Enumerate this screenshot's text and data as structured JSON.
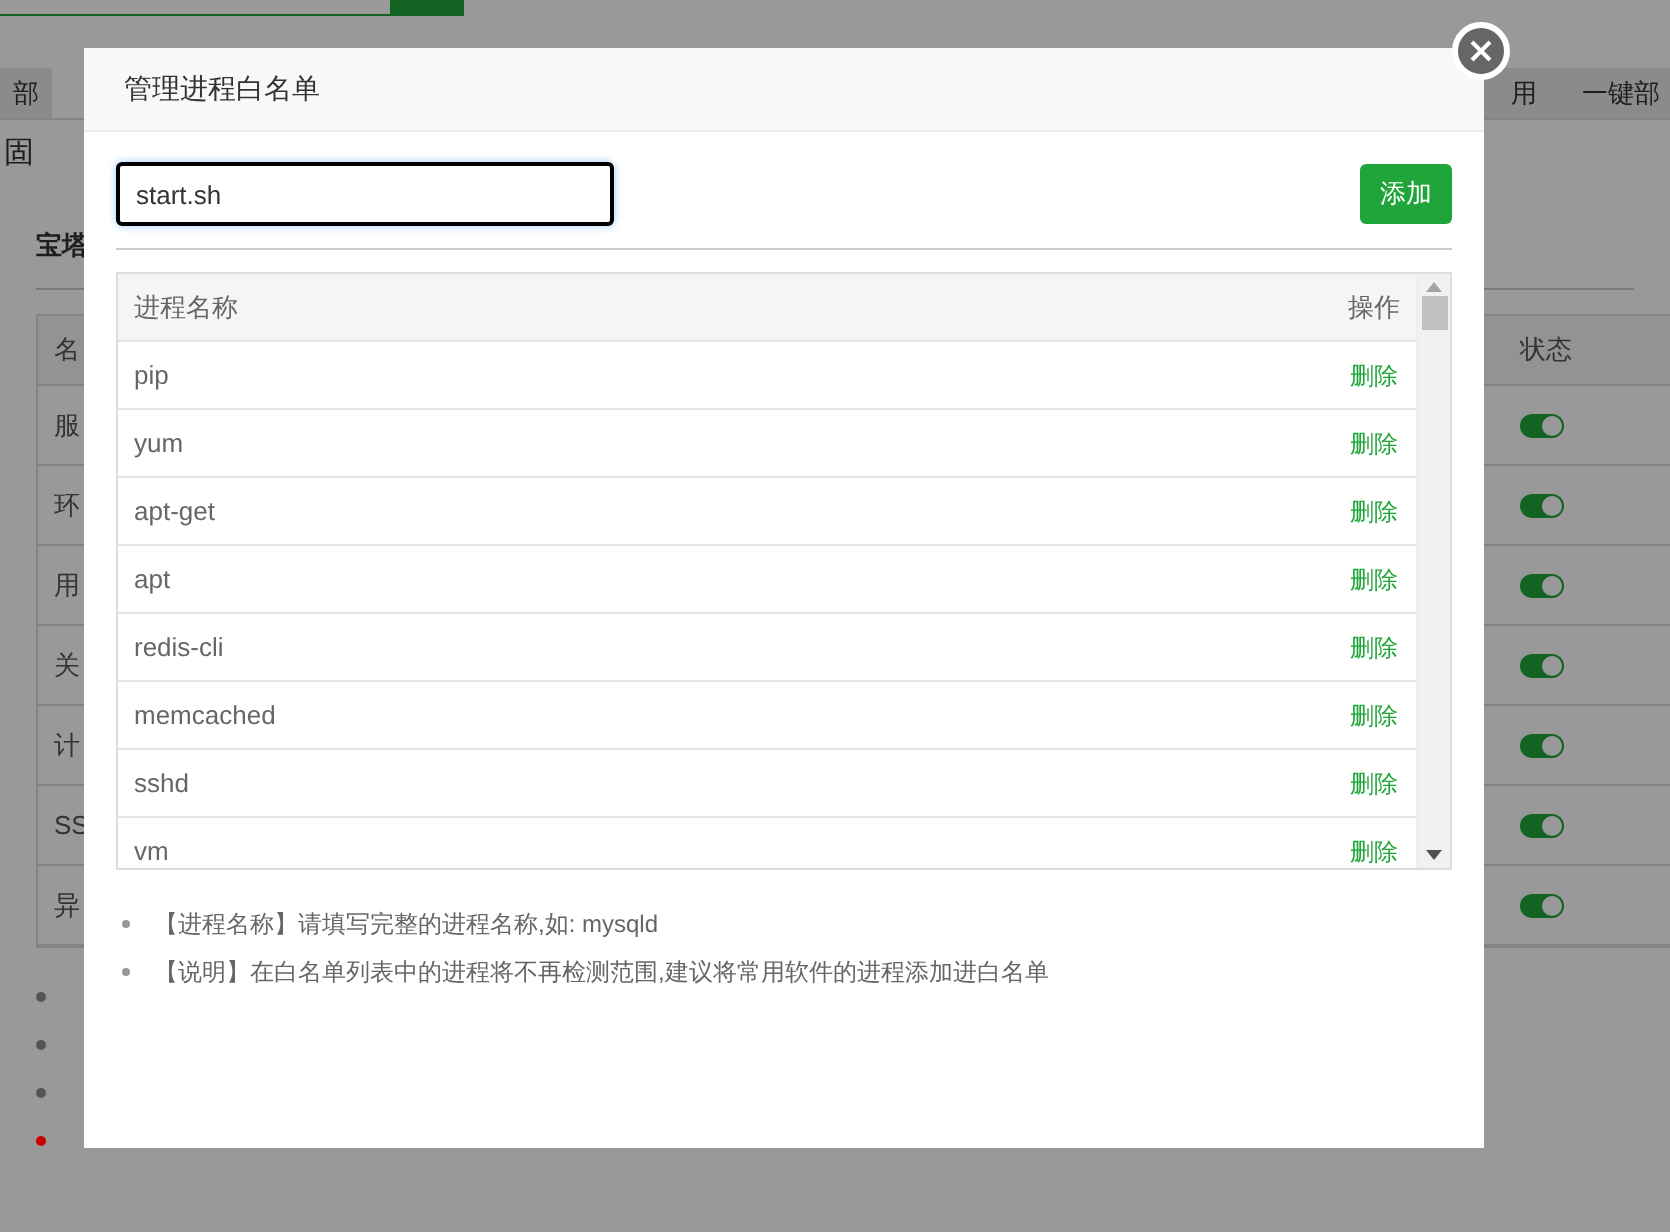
{
  "background": {
    "tabs": [
      {
        "label": "部"
      },
      {
        "label": "用"
      },
      {
        "label": "一键部"
      }
    ],
    "panel_title": "固",
    "section_title": "宝塔",
    "table": {
      "columns": [
        "名",
        "状态"
      ],
      "rows": [
        {
          "name": "服",
          "on": true
        },
        {
          "name": "环",
          "on": true
        },
        {
          "name": "用",
          "on": true
        },
        {
          "name": "关",
          "on": true
        },
        {
          "name": "计",
          "on": true
        },
        {
          "name": "SS",
          "on": true
        },
        {
          "name": "异",
          "on": true
        }
      ]
    },
    "bullets": [
      {
        "color": "#555555"
      },
      {
        "color": "#555555"
      },
      {
        "color": "#555555"
      },
      {
        "color": "#cc0000"
      }
    ]
  },
  "dialog": {
    "title": "管理进程白名单",
    "input": {
      "value": "start.sh"
    },
    "add_button": "添加",
    "table": {
      "columns": [
        "进程名称",
        "操作"
      ],
      "rows": [
        {
          "name": "pip",
          "action": "删除"
        },
        {
          "name": "yum",
          "action": "删除"
        },
        {
          "name": "apt-get",
          "action": "删除"
        },
        {
          "name": "apt",
          "action": "删除"
        },
        {
          "name": "redis-cli",
          "action": "删除"
        },
        {
          "name": "memcached",
          "action": "删除"
        },
        {
          "name": "sshd",
          "action": "删除"
        },
        {
          "name": "vm",
          "action": "删除"
        }
      ]
    },
    "notes": [
      "【进程名称】请填写完整的进程名称,如: mysqld",
      "【说明】在白名单列表中的进程将不再检测范围,建议将常用软件的进程添加进白名单"
    ]
  }
}
